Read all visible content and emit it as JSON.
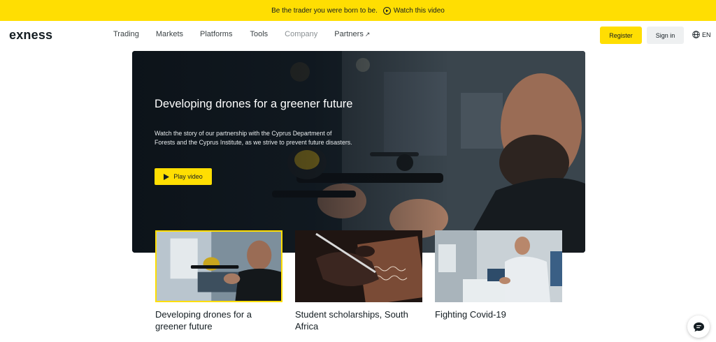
{
  "promo": {
    "text": "Be the trader you were born to be.",
    "link": "Watch this video"
  },
  "nav": {
    "logo": "exness",
    "menu": [
      "Trading",
      "Markets",
      "Platforms",
      "Tools",
      "Company",
      "Partners"
    ],
    "partners_arrow": "↗",
    "register": "Register",
    "signin": "Sign in",
    "lang": "EN"
  },
  "hero": {
    "title": "Developing drones for a greener future",
    "description": "Watch the story of our partnership with the Cyprus Department of Forests and the Cyprus Institute, as we strive to prevent future disasters.",
    "play_label": "Play video"
  },
  "cards": [
    {
      "title": "Developing drones for a greener future",
      "selected": true
    },
    {
      "title": "Student scholarships, South Africa",
      "selected": false
    },
    {
      "title": "Fighting Covid-19",
      "selected": false
    }
  ],
  "colors": {
    "accent": "#ffde02",
    "text": "#141d22",
    "muted": "#8a9093"
  },
  "icons": {
    "promo": "play-circle-icon",
    "lang": "globe-icon",
    "play": "play-icon",
    "chat": "chat-icon"
  }
}
